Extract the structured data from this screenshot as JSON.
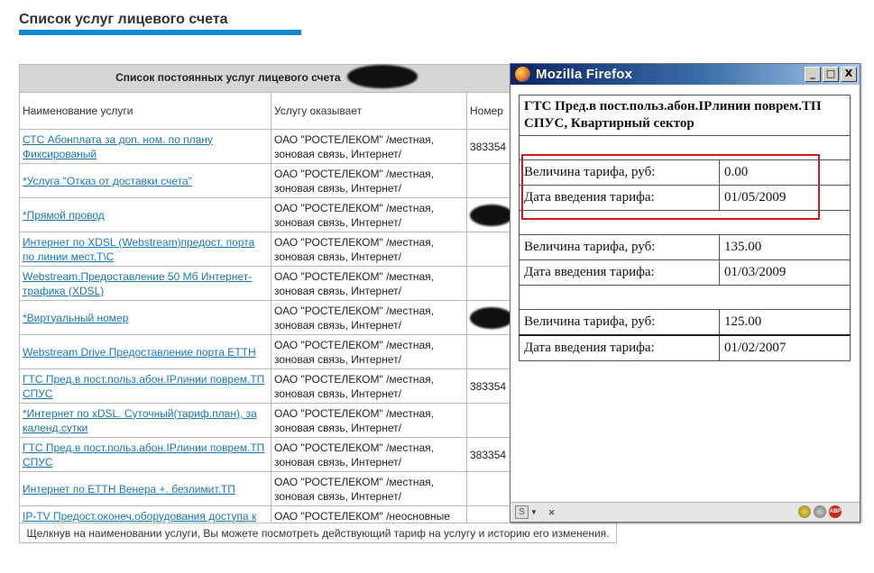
{
  "page": {
    "heading": "Список услуг лицевого счета",
    "accent_color": "#1188d0"
  },
  "services": {
    "caption": "Список постоянных услуг лицевого счета",
    "columns": {
      "name": "Наименование услуги",
      "provider": "Услугу оказывает",
      "number": "Номер"
    },
    "rows": [
      {
        "name": "СТС Абонплата за доп. ном. по плану Фиксированый",
        "provider": "ОАО \"РОСТЕЛЕКОМ\" /местная, зоновая связь, Интернет/",
        "number": "383354"
      },
      {
        "name": "*Услуга \"Отказ от доставки счета\"",
        "provider": "ОАО \"РОСТЕЛЕКОМ\" /местная, зоновая связь, Интернет/",
        "number": ""
      },
      {
        "name": "*Прямой провод",
        "provider": "ОАО \"РОСТЕЛЕКОМ\" /местная, зоновая связь, Интернет/",
        "number": ""
      },
      {
        "name": "Интернет по XDSL (Webstream)предост. порта по линии мест.Т\\С",
        "provider": "ОАО \"РОСТЕЛЕКОМ\" /местная, зоновая связь, Интернет/",
        "number": ""
      },
      {
        "name": "Webstream.Предоставление 50 Мб Интернет-трафика (XDSL)",
        "provider": "ОАО \"РОСТЕЛЕКОМ\" /местная, зоновая связь, Интернет/",
        "number": ""
      },
      {
        "name": "*Виртуальный номер",
        "provider": "ОАО \"РОСТЕЛЕКОМ\" /местная, зоновая связь, Интернет/",
        "number": ""
      },
      {
        "name": "Webstream Drive.Предоставление порта ЕТТН",
        "provider": "ОАО \"РОСТЕЛЕКОМ\" /местная, зоновая связь, Интернет/",
        "number": ""
      },
      {
        "name": "ГТС Пред.в пост.польз.абон.IPлинии поврем.ТП СПУС",
        "provider": "ОАО \"РОСТЕЛЕКОМ\" /местная, зоновая связь, Интернет/",
        "number": "383354"
      },
      {
        "name": "*Интернет по xDSL. Суточный(тариф.план), за календ.сутки",
        "provider": "ОАО \"РОСТЕЛЕКОМ\" /местная, зоновая связь, Интернет/",
        "number": ""
      },
      {
        "name": "ГТС Пред.в пост.польз.абон.IPлинии поврем.ТП СПУС",
        "provider": "ОАО \"РОСТЕЛЕКОМ\" /местная, зоновая связь, Интернет/",
        "number": "383354"
      },
      {
        "name": "Интернет по ЕТТН Венера +. безлимит.ТП",
        "provider": "ОАО \"РОСТЕЛЕКОМ\" /местная, зоновая связь, Интернет/",
        "number": ""
      },
      {
        "name": "IP-TV Предост.оконеч.оборудования доступа к услуге IP-TV/STB",
        "provider": "ОАО \"РОСТЕЛЕКОМ\" /неосновные услуги/",
        "number": ""
      }
    ]
  },
  "footer_note": "Щелкнув на наименовании услуги, Вы можете посмотреть действующий тариф на услугу и историю его изменения.",
  "popup": {
    "window_title": "Mozilla Firefox",
    "buttons": {
      "minimize": "_",
      "maximize": "□",
      "close": "X"
    },
    "service_title": "ГТС Пред.в пост.польз.абон.IPлинии поврем.ТП СПУС, Квартирный сектор",
    "tariffs": [
      {
        "rate_label": "Величина тарифа, руб:",
        "rate": "0.00",
        "date_label": "Дата введения тарифа:",
        "date": "01/05/2009"
      },
      {
        "rate_label": "Величина тарифа, руб:",
        "rate": "135.00",
        "date_label": "Дата введения тарифа:",
        "date": "01/03/2009"
      },
      {
        "rate_label": "Величина тарифа, руб:",
        "rate": "125.00",
        "date_label": "Дата введения тарифа:",
        "date": "01/02/2007"
      }
    ],
    "status_close": "×",
    "highlight_color": "#d21a1a"
  }
}
